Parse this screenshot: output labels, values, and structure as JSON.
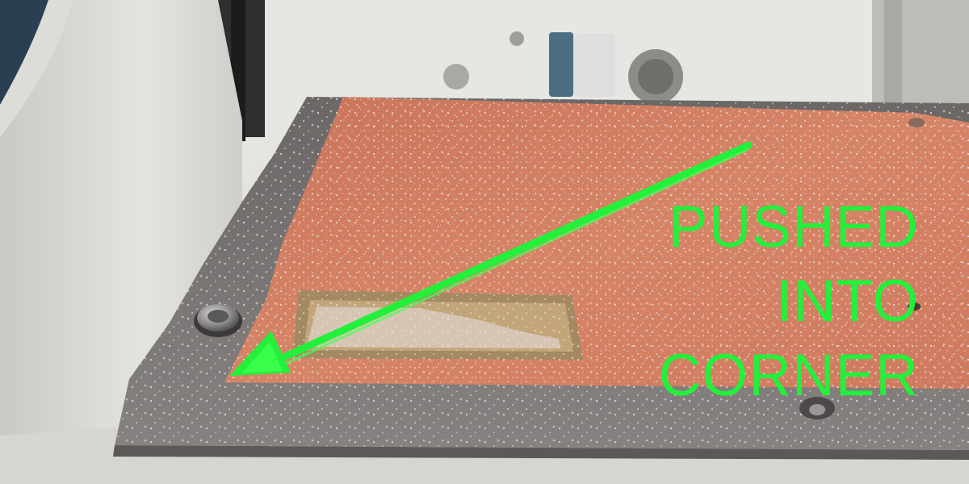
{
  "annotation": {
    "lines": [
      "PUSHED",
      "INTO",
      "CORNER"
    ]
  },
  "colors": {
    "annotation_green": "#22f03a",
    "copper": "#d47a5a",
    "metal_plate": "#7b7776"
  },
  "icons": {
    "arrow": "arrow-pointing-down-left-icon",
    "screw": "screw-head-icon"
  }
}
